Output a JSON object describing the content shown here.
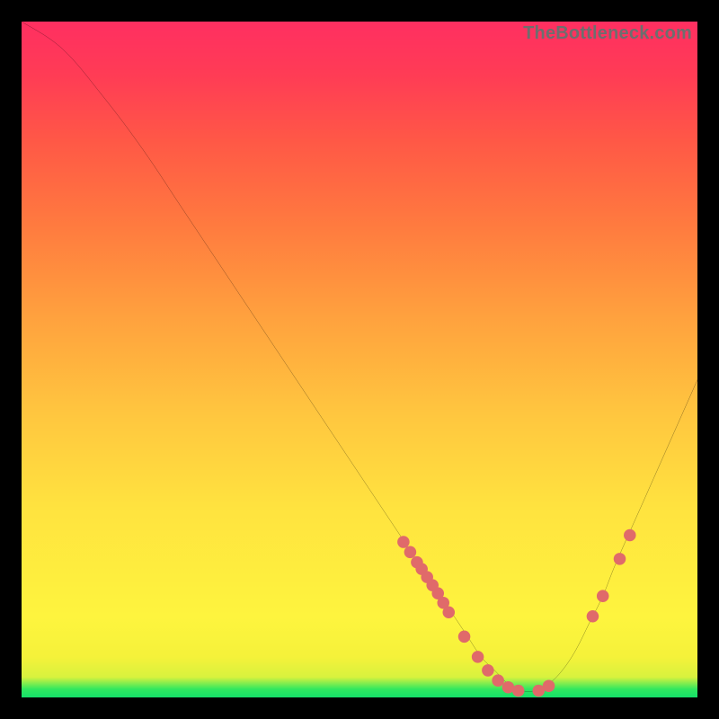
{
  "watermark": "TheBottleneck.com",
  "chart_data": {
    "type": "line",
    "title": "",
    "xlabel": "",
    "ylabel": "",
    "xlim": [
      0,
      100
    ],
    "ylim": [
      0,
      100
    ],
    "grid": false,
    "curve": {
      "comment": "y is vertical position from top in 0-100; visually represents a bottleneck curve that starts high-left, descends, bottoms out near x≈68-78, then rises again toward the right",
      "x": [
        0,
        6,
        12,
        18,
        24,
        30,
        36,
        42,
        48,
        52,
        56,
        58,
        60,
        62,
        64,
        66,
        68,
        70,
        72,
        74,
        76,
        78,
        80,
        82,
        84,
        86,
        88,
        92,
        96,
        100
      ],
      "y": [
        0,
        4,
        11,
        19,
        28,
        37,
        46,
        55,
        64,
        70,
        76,
        79,
        82,
        85,
        88,
        91,
        94,
        96,
        98,
        99,
        99,
        98,
        96,
        93,
        89,
        85,
        80,
        71,
        62,
        53
      ]
    },
    "markers": [
      {
        "x": 56.5,
        "y": 77
      },
      {
        "x": 57.5,
        "y": 78.5
      },
      {
        "x": 58.5,
        "y": 80
      },
      {
        "x": 59.2,
        "y": 81
      },
      {
        "x": 60.0,
        "y": 82.2
      },
      {
        "x": 60.8,
        "y": 83.4
      },
      {
        "x": 61.6,
        "y": 84.6
      },
      {
        "x": 62.4,
        "y": 86
      },
      {
        "x": 63.2,
        "y": 87.4
      },
      {
        "x": 65.5,
        "y": 91
      },
      {
        "x": 67.5,
        "y": 94
      },
      {
        "x": 69.0,
        "y": 96
      },
      {
        "x": 70.5,
        "y": 97.5
      },
      {
        "x": 72.0,
        "y": 98.5
      },
      {
        "x": 73.5,
        "y": 99
      },
      {
        "x": 76.5,
        "y": 99
      },
      {
        "x": 78.0,
        "y": 98.3
      },
      {
        "x": 84.5,
        "y": 88
      },
      {
        "x": 86.0,
        "y": 85
      },
      {
        "x": 88.5,
        "y": 79.5
      },
      {
        "x": 90.0,
        "y": 76
      }
    ],
    "colors": {
      "curve": "#000000",
      "marker": "#e06a6a",
      "gradient_top": "#ff2f61",
      "gradient_bottom": "#15e06a"
    }
  }
}
